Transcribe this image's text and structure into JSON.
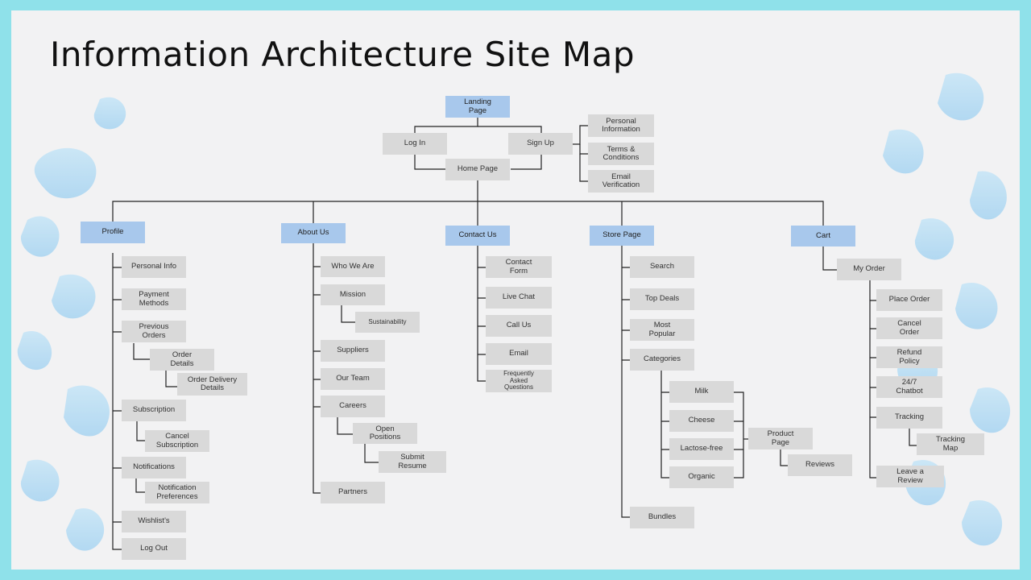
{
  "title": "Information Architecture Site Map",
  "nodes": {
    "landing": "Landing\nPage",
    "login": "Log In",
    "signup": "Sign Up",
    "home": "Home Page",
    "personal_info_top": "Personal\nInformation",
    "terms": "Terms &\nConditions",
    "email_verification": "Email\nVerification",
    "profile": "Profile",
    "personal_info": "Personal Info",
    "payment_methods": "Payment\nMethods",
    "previous_orders": "Previous\nOrders",
    "order_details": "Order\nDetails",
    "order_delivery_details": "Order Delivery\nDetails",
    "subscription": "Subscription",
    "cancel_subscription": "Cancel\nSubscription",
    "notifications": "Notifications",
    "notification_preferences": "Notification\nPreferences",
    "wishlists": "Wishlist's",
    "logout": "Log Out",
    "about": "About Us",
    "who_we_are": "Who We Are",
    "mission": "Mission",
    "sustainability": "Sustainability",
    "suppliers": "Suppliers",
    "our_team": "Our Team",
    "careers": "Careers",
    "open_positions": "Open\nPositions",
    "submit_resume": "Submit\nResume",
    "partners": "Partners",
    "contact": "Contact Us",
    "contact_form": "Contact\nForm",
    "live_chat": "Live Chat",
    "call_us": "Call Us",
    "email": "Email",
    "faq": "Frequently\nAsked\nQuestions",
    "store": "Store Page",
    "search": "Search",
    "top_deals": "Top Deals",
    "most_popular": "Most\nPopular",
    "categories": "Categories",
    "milk": "Milk",
    "cheese": "Cheese",
    "lactose_free": "Lactose-free",
    "organic": "Organic",
    "product_page": "Product\nPage",
    "reviews": "Reviews",
    "bundles": "Bundles",
    "cart": "Cart",
    "my_order": "My Order",
    "place_order": "Place Order",
    "cancel_order": "Cancel\nOrder",
    "refund_policy": "Refund\nPolicy",
    "chatbot": "24/7\nChatbot",
    "tracking": "Tracking",
    "tracking_map": "Tracking\nMap",
    "leave_review": "Leave a\nReview"
  },
  "colors": {
    "frame": "#8fe1ea",
    "background": "#f2f2f3",
    "node": "#d9d9d9",
    "highlight_node": "#a8c8ec",
    "connector": "#222222"
  }
}
